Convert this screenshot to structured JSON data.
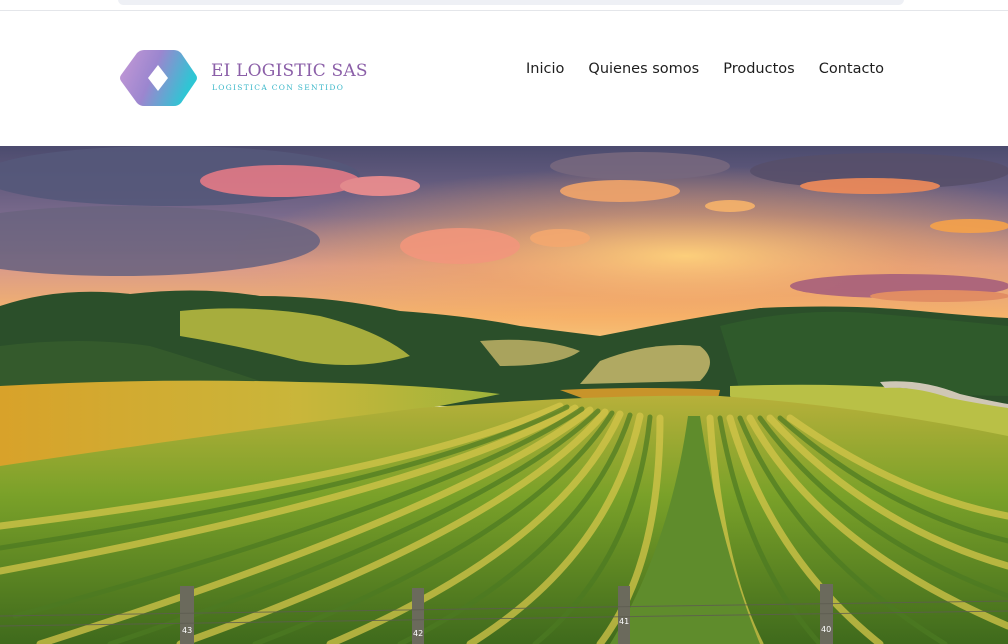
{
  "brand": {
    "name": "EI LOGISTIC SAS",
    "tagline": "LOGISTICA CON SENTIDO",
    "colors": {
      "primary": "#8b5fa8",
      "secondary": "#3ab7c9"
    }
  },
  "nav": {
    "items": [
      {
        "label": "Inicio"
      },
      {
        "label": "Quienes somos"
      },
      {
        "label": "Productos"
      },
      {
        "label": "Contacto"
      }
    ]
  },
  "hero": {
    "image_subject": "vineyard-at-sunset",
    "post_labels": [
      "43",
      "42",
      "41",
      "40"
    ]
  }
}
